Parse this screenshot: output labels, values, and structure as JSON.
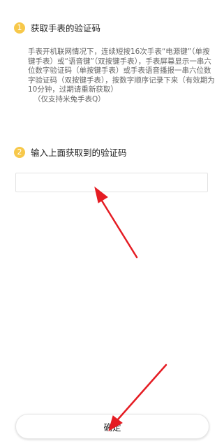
{
  "step1": {
    "number": "1",
    "title": "获取手表的验证码",
    "description": "手表开机联网情况下，连续短按16次手表“电源键”（单按键手表）或“语音键”（双按键手表），手表屏幕显示一串六位数字验证码（单按键手表）或手表语音播报一串六位数字验证码（双按键手表），按数字顺序记录下来（有效期为10分钟，过期请重新获取）",
    "note": "（仅支持米兔手表Q）"
  },
  "step2": {
    "number": "2",
    "title": "输入上面获取到的验证码"
  },
  "code_input": {
    "value": "",
    "placeholder": ""
  },
  "confirm_button": {
    "label": "确定"
  },
  "colors": {
    "badge": "#f7c84a",
    "arrow": "#e51c23"
  }
}
